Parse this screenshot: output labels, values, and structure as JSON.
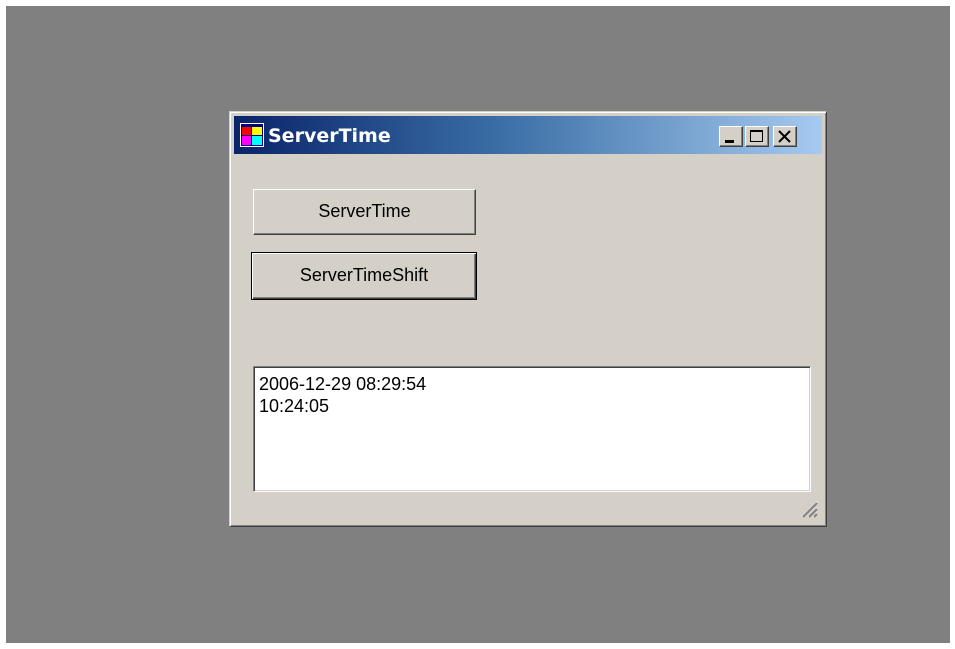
{
  "window": {
    "title": "ServerTime"
  },
  "buttons": {
    "server_time_label": "ServerTime",
    "server_time_shift_label": "ServerTimeShift"
  },
  "output": {
    "lines": [
      "2006-12-29 08:29:54",
      "10:24:05"
    ]
  },
  "icons": {
    "app": "app-window-icon",
    "minimize": "minimize-icon",
    "maximize": "maximize-icon",
    "close": "close-icon",
    "resize": "resize-grip-icon"
  },
  "colors": {
    "desktop": "#808080",
    "window_face": "#d4d0c8",
    "titlebar_start": "#0a246a",
    "titlebar_end": "#a6caf0",
    "title_text": "#ffffff"
  }
}
